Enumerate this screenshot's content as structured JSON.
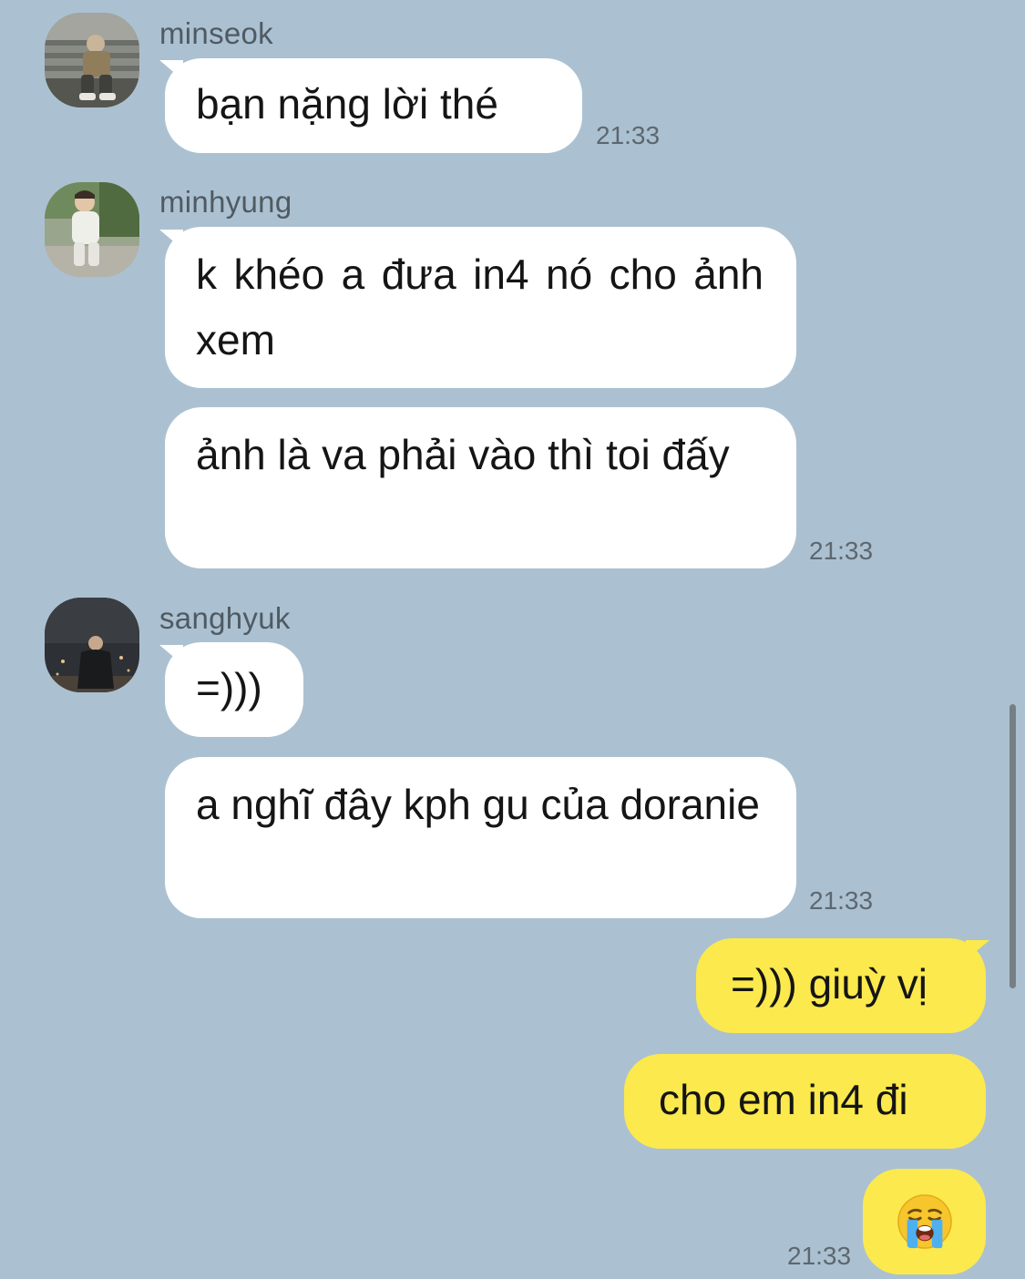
{
  "messages": {
    "group1": {
      "sender": "minseok",
      "avatar": "avatar-photo-minseok",
      "bubbles": [
        "bạn nặng lời thé"
      ],
      "time": "21:33"
    },
    "group2": {
      "sender": "minhyung",
      "avatar": "avatar-photo-minhyung",
      "bubbles": [
        "k khéo a đưa in4 nó cho ảnh xem",
        "ảnh là va phải vào thì toi đấy"
      ],
      "time": "21:33"
    },
    "group3": {
      "sender": "sanghyuk",
      "avatar": "avatar-photo-sanghyuk",
      "bubbles": [
        "=)))",
        "a nghĩ đây kph gu của doranie"
      ],
      "time": "21:33"
    },
    "mine": {
      "bubbles": [
        "=))) giuỳ vị",
        "cho em in4 đi"
      ],
      "emoji": "loudly-crying-face-icon",
      "time": "21:33"
    }
  },
  "colors": {
    "background": "#abc1d1",
    "incoming_bubble": "#ffffff",
    "outgoing_bubble": "#fbe94d"
  }
}
